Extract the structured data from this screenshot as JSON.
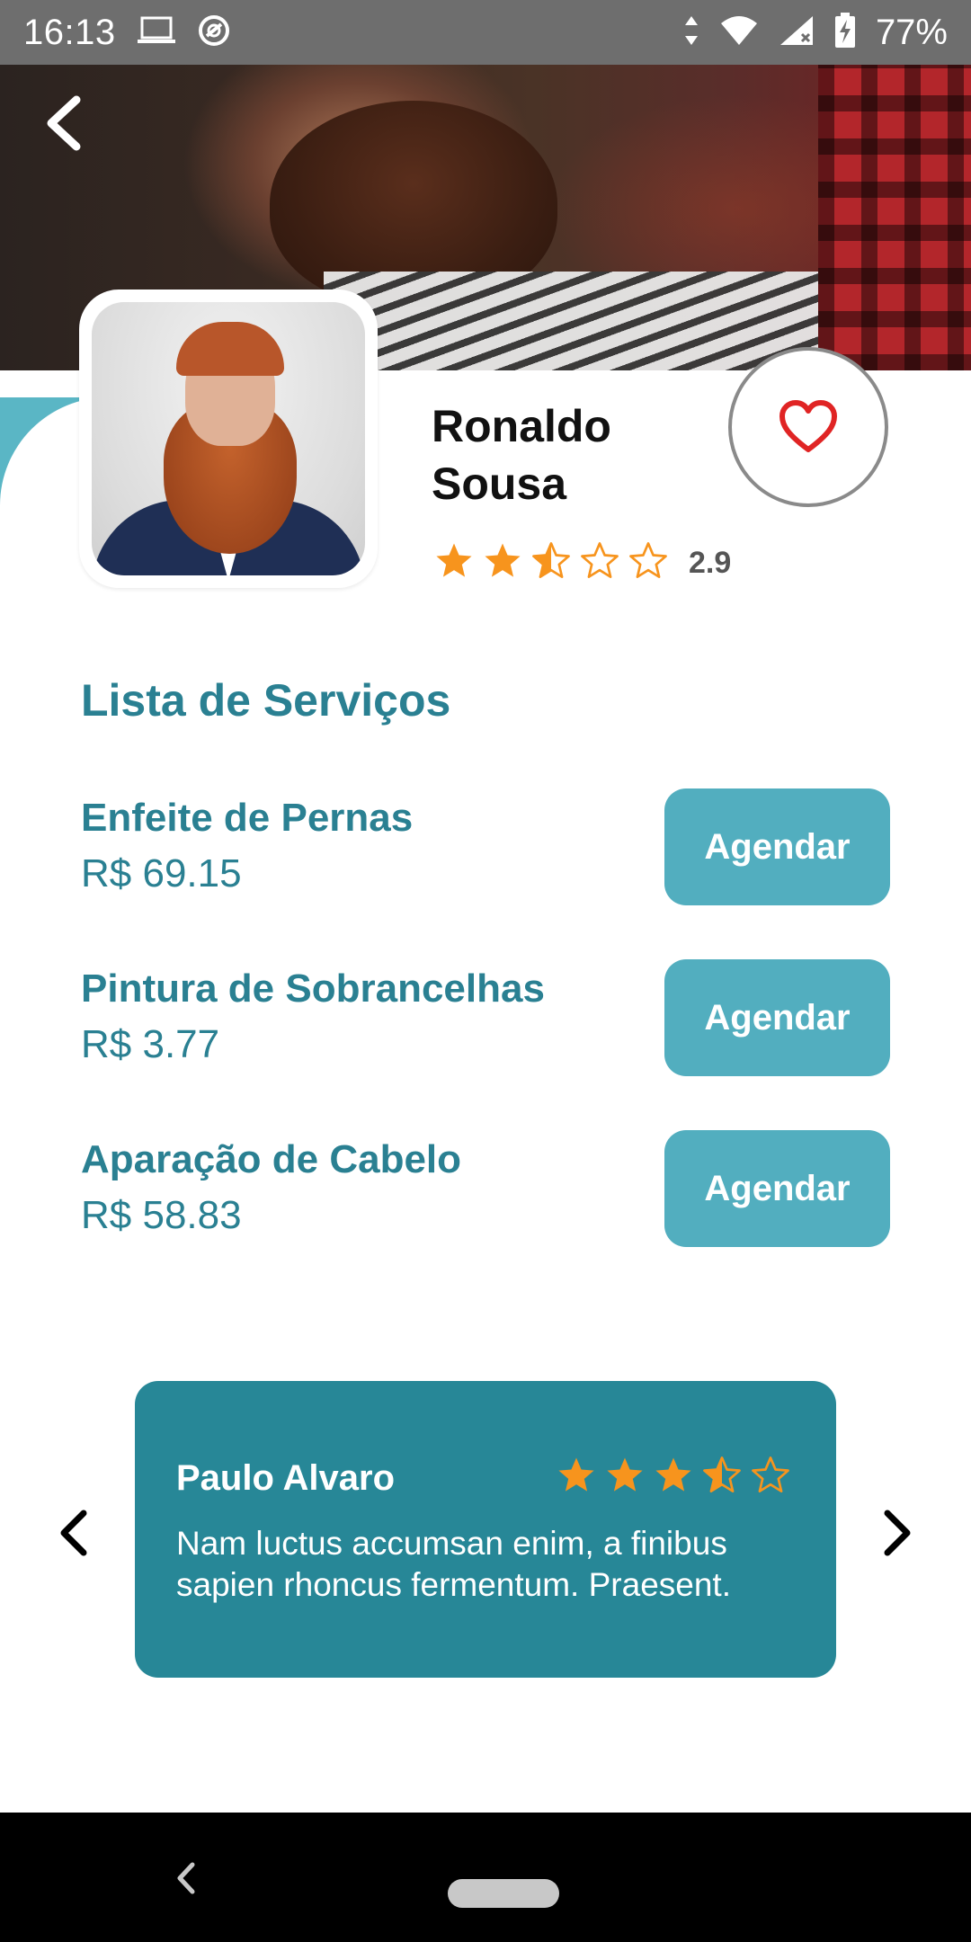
{
  "status_bar": {
    "time": "16:13",
    "battery": "77%",
    "icons": [
      "laptop-icon",
      "sync-icon",
      "data-arrows-icon",
      "wifi-icon",
      "signal-icon",
      "battery-charging-icon"
    ]
  },
  "header": {
    "back_icon": "chevron-left-icon",
    "hero_image": "barber-trimming-beard-photo"
  },
  "profile": {
    "name": "Ronaldo Sousa",
    "rating": 2.9,
    "rating_label": "2.9",
    "favorite_icon": "heart-outline-icon",
    "avatar": "bearded-man-portrait"
  },
  "services": {
    "title": "Lista de Serviços",
    "items": [
      {
        "name": "Enfeite de Pernas",
        "price": "R$ 69.15",
        "button": "Agendar"
      },
      {
        "name": "Pintura de Sobrancelhas",
        "price": "R$ 3.77",
        "button": "Agendar"
      },
      {
        "name": "Aparação de Cabelo",
        "price": "R$ 58.83",
        "button": "Agendar"
      }
    ]
  },
  "review": {
    "author": "Paulo Alvaro",
    "rating": 3.5,
    "text": "Nam luctus accumsan enim, a finibus sapien rhoncus fermentum. Praesent."
  },
  "colors": {
    "primary": "#2a8092",
    "button": "#52aebf",
    "review_card": "#278797",
    "star": "#f7941d",
    "heart": "#e02424"
  }
}
